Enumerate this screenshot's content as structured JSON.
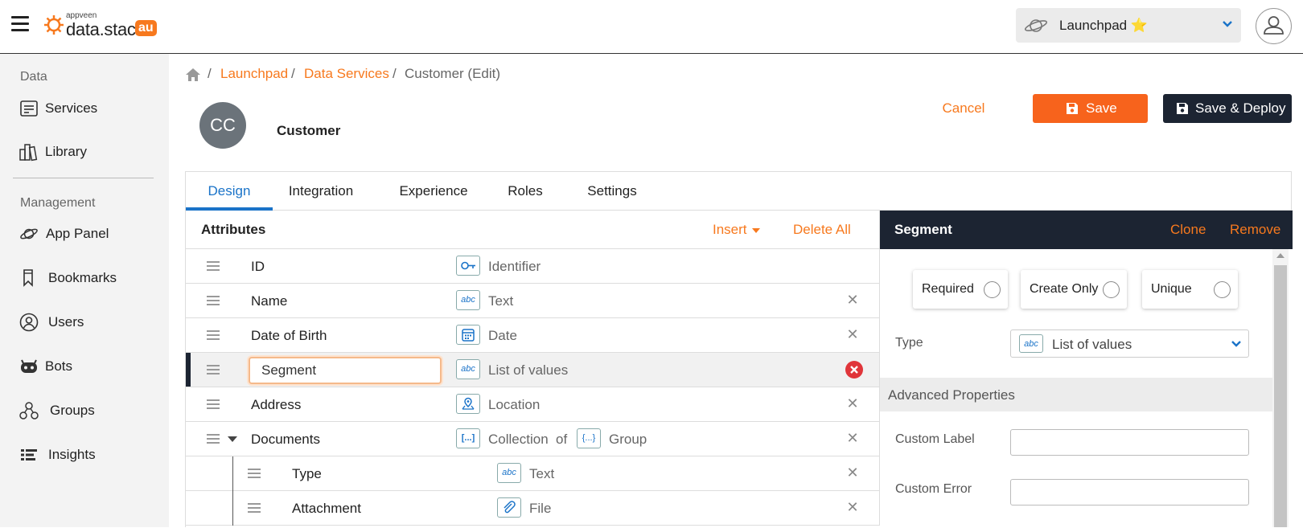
{
  "header": {
    "logo_small": "appveen",
    "logo_big": "data.stack",
    "logo_badge": "au",
    "app_selector": "Launchpad ⭐"
  },
  "sidebar": {
    "section_data": "Data",
    "section_management": "Management",
    "items": [
      {
        "label": "Services",
        "icon": "services-icon"
      },
      {
        "label": "Library",
        "icon": "library-icon"
      },
      {
        "label": "App Panel",
        "icon": "planet-icon"
      },
      {
        "label": "Bookmarks",
        "icon": "bookmark-icon"
      },
      {
        "label": "Users",
        "icon": "user-icon"
      },
      {
        "label": "Bots",
        "icon": "bot-icon"
      },
      {
        "label": "Groups",
        "icon": "groups-icon"
      },
      {
        "label": "Insights",
        "icon": "insights-icon"
      }
    ]
  },
  "breadcrumb": {
    "sep": "/",
    "items": [
      "Launchpad",
      "Data Services",
      "Customer (Edit)"
    ]
  },
  "service": {
    "initials": "CC",
    "name": "Customer"
  },
  "actions": {
    "cancel": "Cancel",
    "save": "Save",
    "save_deploy": "Save & Deploy"
  },
  "tabs": [
    "Design",
    "Integration",
    "Experience",
    "Roles",
    "Settings"
  ],
  "attributes": {
    "title": "Attributes",
    "insert": "Insert",
    "delete_all": "Delete All",
    "rows": [
      {
        "name": "ID",
        "type": "Identifier"
      },
      {
        "name": "Name",
        "type": "Text"
      },
      {
        "name": "Date of Birth",
        "type": "Date"
      },
      {
        "name": "Segment",
        "type": "List of values"
      },
      {
        "name": "Address",
        "type": "Location"
      },
      {
        "name": "Documents",
        "type": "Collection",
        "of": "of",
        "subtype": "Group"
      },
      {
        "name": "Type",
        "type": "Text"
      },
      {
        "name": "Attachment",
        "type": "File"
      }
    ]
  },
  "type_badges": {
    "abc": "abc",
    "array": "[...]",
    "group": "{...}"
  },
  "properties": {
    "title": "Segment",
    "clone": "Clone",
    "remove": "Remove",
    "required": "Required",
    "create_only": "Create Only",
    "unique": "Unique",
    "type_label": "Type",
    "type_value": "List of values",
    "advanced": "Advanced Properties",
    "custom_label": "Custom Label",
    "custom_error": "Custom Error"
  },
  "colors": {
    "accent": "#f7791e",
    "dark": "#1c2432",
    "link_blue": "#1a73c8",
    "danger": "#e0353a"
  }
}
